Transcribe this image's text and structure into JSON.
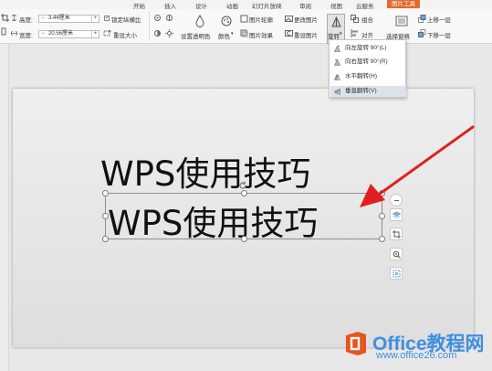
{
  "tabs": [
    {
      "label": "开始",
      "active": false
    },
    {
      "label": "插入",
      "active": false
    },
    {
      "label": "设计",
      "active": false
    },
    {
      "label": "动画",
      "active": false
    },
    {
      "label": "幻灯片放映",
      "active": false
    },
    {
      "label": "审阅",
      "active": false
    },
    {
      "label": "视图",
      "active": false
    },
    {
      "label": "云服务",
      "active": false
    },
    {
      "label": "图片工具",
      "active": true
    }
  ],
  "ribbon": {
    "height_label": "高度:",
    "height_value": "3.44厘米",
    "width_label": "宽度:",
    "width_value": "20.56厘米",
    "spin_minus": "−",
    "spin_plus": "+",
    "lock_ratio_label": "锁定纵横比",
    "reset_size_label": "重设大小",
    "transparency_label": "设置透明色",
    "color_label": "颜色",
    "picture_outline_label": "图片轮廓",
    "picture_effects_label": "图片效果",
    "change_picture_label": "更改图片",
    "reset_picture_label": "重设图片",
    "rotate_label": "旋转",
    "group_label": "组合",
    "align_label": "对齐",
    "selection_pane_label": "选择窗格",
    "bring_forward_label": "上移一层",
    "send_backward_label": "下移一层"
  },
  "rotate_menu": [
    {
      "label": "向左旋转 90°(L)",
      "icon": "rotate-left-icon"
    },
    {
      "label": "向右旋转 90°(R)",
      "icon": "rotate-right-icon"
    },
    {
      "label": "水平翻转(H)",
      "icon": "flip-horizontal-icon"
    },
    {
      "label": "垂直翻转(V)",
      "icon": "flip-vertical-icon",
      "hover": true
    }
  ],
  "slide": {
    "text_original": "WPS使用技巧",
    "text_flipped": "WPS使用技巧"
  },
  "watermark": {
    "title": "Office教程网",
    "url": "www.office26.com"
  },
  "colors": {
    "accent_tab": "#e26a2c",
    "arrow": "#e02020",
    "watermark": "#3e8fe0",
    "logo": "#e8541e"
  }
}
